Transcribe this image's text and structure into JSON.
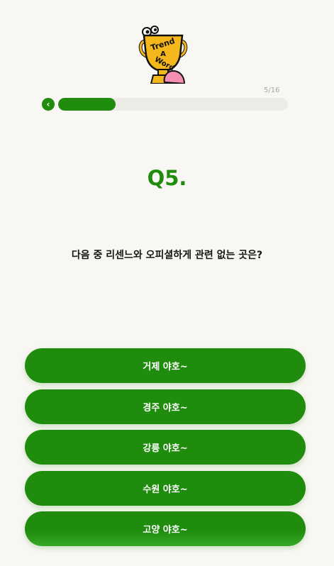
{
  "header": {
    "logo_text": "Trend A Word",
    "progress": {
      "current": 5,
      "total": 16,
      "label": "5/16",
      "fraction": 0.25
    },
    "back_icon": "chevron-left-icon"
  },
  "question": {
    "number_label": "Q5.",
    "text": "다음 중 리센느와 오피셜하게 관련 없는 곳은?"
  },
  "answers": [
    {
      "label": "거제 야호~"
    },
    {
      "label": "경주 야호~"
    },
    {
      "label": "강릉 야호~"
    },
    {
      "label": "수원 야호~"
    },
    {
      "label": "고양 야호~"
    }
  ],
  "colors": {
    "accent": "#1f8c0d",
    "background": "#f9f7f3",
    "track": "#ecebe6"
  }
}
